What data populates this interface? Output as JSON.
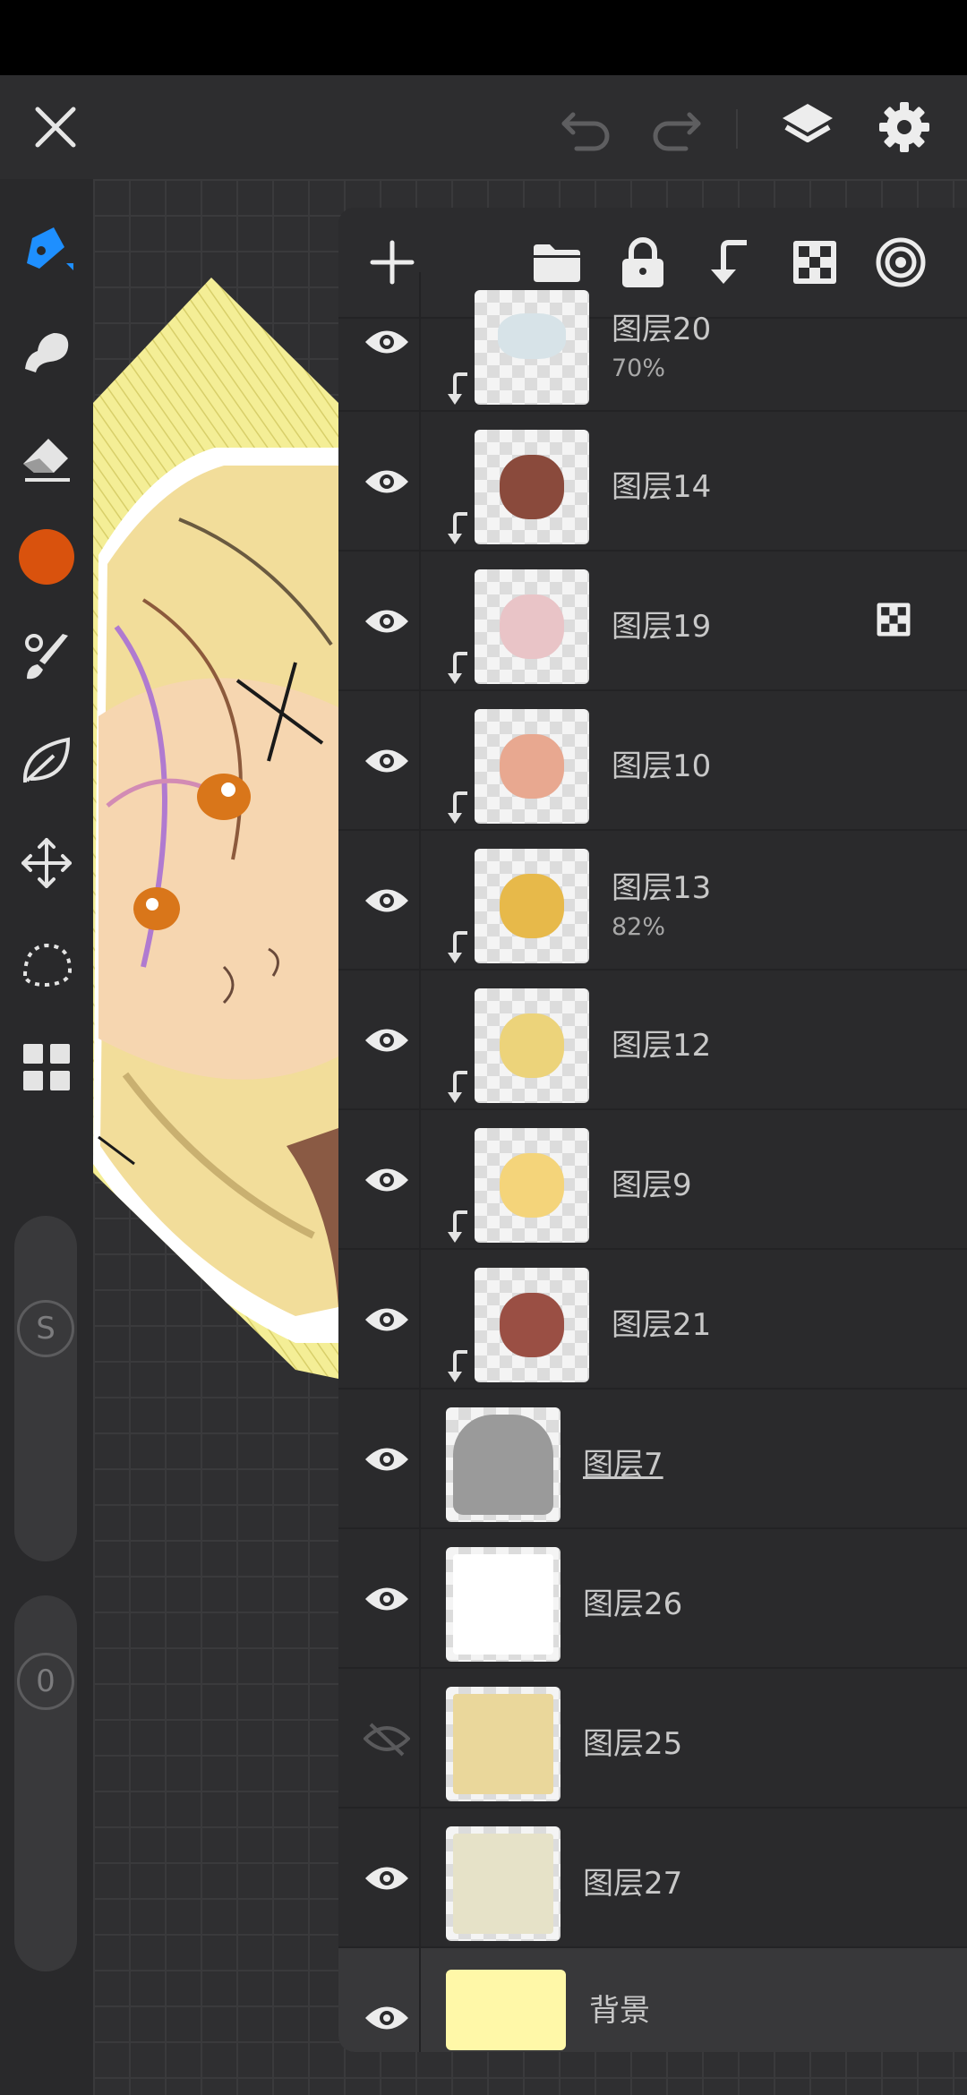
{
  "app": {
    "accent": "#1e8fff",
    "brush_color": "#d9520d"
  },
  "icons": {
    "close": "close-icon",
    "undo": "undo-icon",
    "redo": "redo-icon",
    "layers": "layers-icon",
    "settings": "gear-icon"
  },
  "sidebar": {
    "tools": [
      "pen-tool",
      "smudge-tool",
      "eraser-tool",
      "color-swatch",
      "brush-library",
      "leaf-tool",
      "transform-tool",
      "lasso-tool",
      "grid-tool"
    ],
    "size_label": "S",
    "opacity_label": "0"
  },
  "layers_panel": {
    "toolbar": [
      "add-layer",
      "folder",
      "lock",
      "clip",
      "alpha-lock",
      "blend"
    ],
    "layers": [
      {
        "name": "图层20",
        "opacity": "70%",
        "visible": true,
        "clipped": true,
        "thumb": "#d7e3e8"
      },
      {
        "name": "图层14",
        "opacity": "",
        "visible": true,
        "clipped": true,
        "thumb": "#8a4a3c"
      },
      {
        "name": "图层19",
        "opacity": "",
        "visible": true,
        "clipped": true,
        "thumb": "#e9c4c7",
        "alpha_lock": true
      },
      {
        "name": "图层10",
        "opacity": "",
        "visible": true,
        "clipped": true,
        "thumb": "#e8a890"
      },
      {
        "name": "图层13",
        "opacity": "82%",
        "visible": true,
        "clipped": true,
        "thumb": "#e7b94a"
      },
      {
        "name": "图层12",
        "opacity": "",
        "visible": true,
        "clipped": true,
        "thumb": "#ecd37a"
      },
      {
        "name": "图层9",
        "opacity": "",
        "visible": true,
        "clipped": true,
        "thumb": "#f4d47a"
      },
      {
        "name": "图层21",
        "opacity": "",
        "visible": true,
        "clipped": true,
        "thumb": "#9a4f44"
      },
      {
        "name": "图层7",
        "opacity": "",
        "visible": true,
        "clipped": false,
        "thumb": "#9a9a9a",
        "underline": true
      },
      {
        "name": "图层26",
        "opacity": "",
        "visible": true,
        "clipped": false,
        "thumb": "#ffffff"
      },
      {
        "name": "图层25",
        "opacity": "",
        "visible": false,
        "clipped": false,
        "thumb": "#ead79b"
      },
      {
        "name": "图层27",
        "opacity": "",
        "visible": true,
        "clipped": false,
        "thumb": "#e6e2c8"
      },
      {
        "name": "背景",
        "opacity": "",
        "visible": true,
        "clipped": false,
        "thumb": "#fff8a8",
        "selected": true
      }
    ]
  }
}
